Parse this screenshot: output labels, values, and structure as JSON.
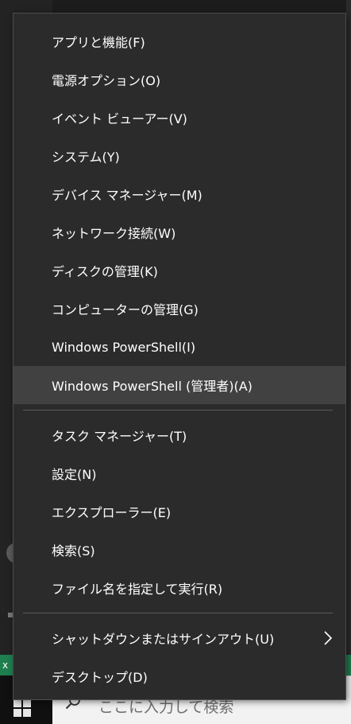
{
  "menu": {
    "items": [
      {
        "label": "アプリと機能(F)"
      },
      {
        "label": "電源オプション(O)"
      },
      {
        "label": "イベント ビューアー(V)"
      },
      {
        "label": "システム(Y)"
      },
      {
        "label": "デバイス マネージャー(M)"
      },
      {
        "label": "ネットワーク接続(W)"
      },
      {
        "label": "ディスクの管理(K)"
      },
      {
        "label": "コンピューターの管理(G)"
      },
      {
        "label": "Windows PowerShell(I)"
      },
      {
        "label": "Windows PowerShell (管理者)(A)",
        "highlighted": true
      },
      {
        "label": "タスク マネージャー(T)"
      },
      {
        "label": "設定(N)"
      },
      {
        "label": "エクスプローラー(E)"
      },
      {
        "label": "検索(S)"
      },
      {
        "label": "ファイル名を指定して実行(R)"
      },
      {
        "label": "シャットダウンまたはサインアウト(U)",
        "submenu": true
      },
      {
        "label": "デスクトップ(D)"
      }
    ]
  },
  "taskbar": {
    "search_placeholder": "ここに入力して検索",
    "start_icon": "windows-logo-icon",
    "search_icon": "search-icon"
  },
  "colors": {
    "menu_background": "#2b2b2b",
    "menu_highlight": "#414141",
    "menu_text": "#ffffff",
    "separator": "#5a5a5a",
    "taskbar": "#101010",
    "search_box": "#f2f2f2"
  }
}
